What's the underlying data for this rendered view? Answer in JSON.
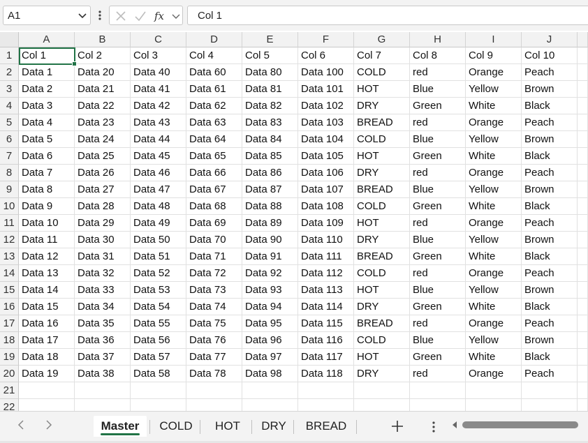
{
  "formula_bar": {
    "name_box": "A1",
    "formula": "Col 1"
  },
  "columns": [
    "A",
    "B",
    "C",
    "D",
    "E",
    "F",
    "G",
    "H",
    "I",
    "J"
  ],
  "rows": [
    [
      "Col 1",
      "Col 2",
      "Col 3",
      "Col 4",
      "Col 5",
      "Col 6",
      "Col 7",
      "Col 8",
      "Col 9",
      "Col 10"
    ],
    [
      "Data 1",
      "Data 20",
      "Data 40",
      "Data 60",
      "Data 80",
      "Data 100",
      "COLD",
      "red",
      "Orange",
      "Peach"
    ],
    [
      "Data 2",
      "Data 21",
      "Data 41",
      "Data 61",
      "Data 81",
      "Data 101",
      "HOT",
      "Blue",
      "Yellow",
      "Brown"
    ],
    [
      "Data 3",
      "Data 22",
      "Data 42",
      "Data 62",
      "Data 82",
      "Data 102",
      "DRY",
      "Green",
      "White",
      "Black"
    ],
    [
      "Data 4",
      "Data 23",
      "Data 43",
      "Data 63",
      "Data 83",
      "Data 103",
      "BREAD",
      "red",
      "Orange",
      "Peach"
    ],
    [
      "Data 5",
      "Data 24",
      "Data 44",
      "Data 64",
      "Data 84",
      "Data 104",
      "COLD",
      "Blue",
      "Yellow",
      "Brown"
    ],
    [
      "Data 6",
      "Data 25",
      "Data 45",
      "Data 65",
      "Data 85",
      "Data 105",
      "HOT",
      "Green",
      "White",
      "Black"
    ],
    [
      "Data 7",
      "Data 26",
      "Data 46",
      "Data 66",
      "Data 86",
      "Data 106",
      "DRY",
      "red",
      "Orange",
      "Peach"
    ],
    [
      "Data 8",
      "Data 27",
      "Data 47",
      "Data 67",
      "Data 87",
      "Data 107",
      "BREAD",
      "Blue",
      "Yellow",
      "Brown"
    ],
    [
      "Data 9",
      "Data 28",
      "Data 48",
      "Data 68",
      "Data 88",
      "Data 108",
      "COLD",
      "Green",
      "White",
      "Black"
    ],
    [
      "Data 10",
      "Data 29",
      "Data 49",
      "Data 69",
      "Data 89",
      "Data 109",
      "HOT",
      "red",
      "Orange",
      "Peach"
    ],
    [
      "Data 11",
      "Data 30",
      "Data 50",
      "Data 70",
      "Data 90",
      "Data 110",
      "DRY",
      "Blue",
      "Yellow",
      "Brown"
    ],
    [
      "Data 12",
      "Data 31",
      "Data 51",
      "Data 71",
      "Data 91",
      "Data 111",
      "BREAD",
      "Green",
      "White",
      "Black"
    ],
    [
      "Data 13",
      "Data 32",
      "Data 52",
      "Data 72",
      "Data 92",
      "Data 112",
      "COLD",
      "red",
      "Orange",
      "Peach"
    ],
    [
      "Data 14",
      "Data 33",
      "Data 53",
      "Data 73",
      "Data 93",
      "Data 113",
      "HOT",
      "Blue",
      "Yellow",
      "Brown"
    ],
    [
      "Data 15",
      "Data 34",
      "Data 54",
      "Data 74",
      "Data 94",
      "Data 114",
      "DRY",
      "Green",
      "White",
      "Black"
    ],
    [
      "Data 16",
      "Data 35",
      "Data 55",
      "Data 75",
      "Data 95",
      "Data 115",
      "BREAD",
      "red",
      "Orange",
      "Peach"
    ],
    [
      "Data 17",
      "Data 36",
      "Data 56",
      "Data 76",
      "Data 96",
      "Data 116",
      "COLD",
      "Blue",
      "Yellow",
      "Brown"
    ],
    [
      "Data 18",
      "Data 37",
      "Data 57",
      "Data 77",
      "Data 97",
      "Data 117",
      "HOT",
      "Green",
      "White",
      "Black"
    ],
    [
      "Data 19",
      "Data 38",
      "Data 58",
      "Data 78",
      "Data 98",
      "Data 118",
      "DRY",
      "red",
      "Orange",
      "Peach"
    ],
    [
      "",
      "",
      "",
      "",
      "",
      "",
      "",
      "",
      "",
      ""
    ],
    [
      "",
      "",
      "",
      "",
      "",
      "",
      "",
      "",
      "",
      ""
    ]
  ],
  "row_numbers": [
    "1",
    "2",
    "3",
    "4",
    "5",
    "6",
    "7",
    "8",
    "9",
    "10",
    "11",
    "12",
    "13",
    "14",
    "15",
    "16",
    "17",
    "18",
    "19",
    "20",
    "21",
    "22"
  ],
  "sheet_tabs": [
    {
      "label": "Master",
      "active": true
    },
    {
      "label": "COLD",
      "active": false
    },
    {
      "label": "HOT",
      "active": false
    },
    {
      "label": "DRY",
      "active": false
    },
    {
      "label": "BREAD",
      "active": false
    }
  ],
  "colors": {
    "accent": "#217346",
    "header_bg": "#f2f2f2",
    "gridline": "#e1e1e1"
  },
  "icons": {
    "name_box_dropdown": "chevron-down-icon",
    "cancel": "close-icon",
    "enter": "check-icon",
    "insert_function": "fx-icon",
    "prev_sheet": "chevron-left-icon",
    "next_sheet": "chevron-right-icon",
    "add_sheet": "plus-icon",
    "more": "vertical-dots-icon"
  }
}
